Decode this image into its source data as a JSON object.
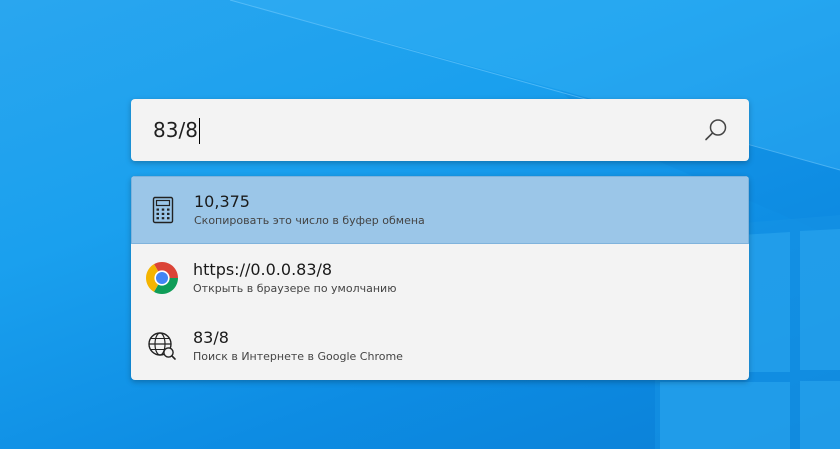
{
  "search": {
    "value": "83/8",
    "icon": "search-icon"
  },
  "results": [
    {
      "title": "10,375",
      "subtitle": "Скопировать это число в буфер обмена",
      "icon": "calculator-icon",
      "selected": true
    },
    {
      "title": "https://0.0.0.83/8",
      "subtitle": "Открыть в браузере по умолчанию",
      "icon": "chrome-icon",
      "selected": false
    },
    {
      "title": "83/8",
      "subtitle": "Поиск в Интернете в Google Chrome",
      "icon": "web-search-icon",
      "selected": false
    }
  ],
  "colors": {
    "desktop_background": "#1aa0ee",
    "selected_row": "#9bc6e8",
    "panel": "#f3f3f3"
  }
}
